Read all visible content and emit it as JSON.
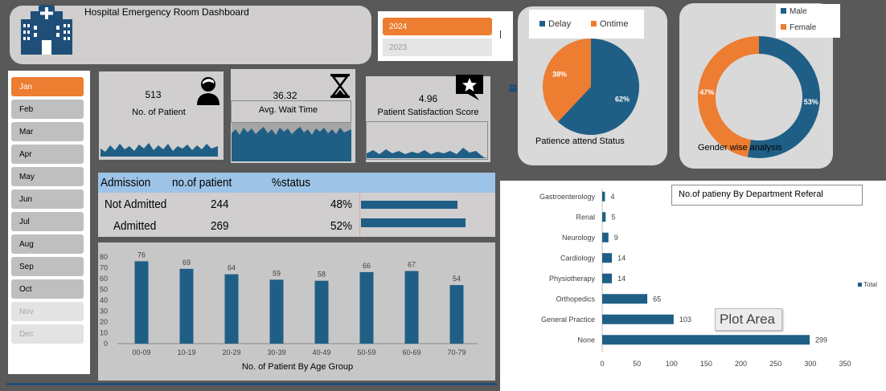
{
  "header": {
    "title": "Hospital Emergency Room Dashboard",
    "logo_icon": "hospital-icon"
  },
  "years": [
    {
      "label": "2024",
      "selected": true
    },
    {
      "label": "2023",
      "selected": false
    }
  ],
  "months": [
    {
      "label": "Jan",
      "state": "on"
    },
    {
      "label": "Feb",
      "state": ""
    },
    {
      "label": "Mar",
      "state": ""
    },
    {
      "label": "Apr",
      "state": ""
    },
    {
      "label": "May",
      "state": ""
    },
    {
      "label": "Jun",
      "state": ""
    },
    {
      "label": "Jul",
      "state": ""
    },
    {
      "label": "Aug",
      "state": ""
    },
    {
      "label": "Sep",
      "state": ""
    },
    {
      "label": "Oct",
      "state": ""
    },
    {
      "label": "Nov",
      "state": "off"
    },
    {
      "label": "Dec",
      "state": "off"
    }
  ],
  "kpis": {
    "patients": {
      "value": "513",
      "label": "No. of Patient",
      "icon": "person-icon"
    },
    "wait": {
      "value": "36.32",
      "label": "Avg. Wait Time",
      "icon": "hourglass-icon"
    },
    "satisfaction": {
      "value": "4.96",
      "label": "Patient Satisfaction Score",
      "icon": "star-speech-icon"
    }
  },
  "admission": {
    "headers": [
      "Admission",
      "no.of patient",
      "%status"
    ],
    "rows": [
      {
        "label": "Not Admitted",
        "count": "244",
        "pct": "48%",
        "fraction": 0.48
      },
      {
        "label": "Admitted",
        "count": "269",
        "pct": "52%",
        "fraction": 0.52
      }
    ]
  },
  "status_pie": {
    "caption": "Patience attend Status",
    "legend": [
      "Delay",
      "Ontime"
    ],
    "slices": [
      {
        "name": "Delay",
        "value": 62,
        "label": "62%",
        "color": "#1f5f86"
      },
      {
        "name": "Ontime",
        "value": 38,
        "label": "38%",
        "color": "#ed7d31"
      }
    ]
  },
  "gender_donut": {
    "caption": "Gender wise analysis",
    "legend": [
      "Male",
      "Female"
    ],
    "slices": [
      {
        "name": "Male",
        "value": 53,
        "label": "53%",
        "color": "#1f5f86"
      },
      {
        "name": "Female",
        "value": 47,
        "label": "47%",
        "color": "#ed7d31"
      }
    ]
  },
  "colors": {
    "accent": "#ed7d31",
    "bar": "#1f5f86",
    "panel": "#d0cece",
    "background": "#595959"
  },
  "chart_data": [
    {
      "type": "bar",
      "xlabel": "No. of Patient By Age Group",
      "categories": [
        "00-09",
        "10-19",
        "20-29",
        "30-39",
        "40-49",
        "50-59",
        "60-69",
        "70-79"
      ],
      "values": [
        76,
        69,
        64,
        59,
        58,
        66,
        67,
        54
      ],
      "ylim": [
        0,
        80
      ],
      "yticks": [
        0,
        10,
        20,
        30,
        40,
        50,
        60,
        70,
        80
      ]
    },
    {
      "type": "bar",
      "orientation": "horizontal",
      "title": "No.of patieny By Department Referal",
      "categories": [
        "Gastroenterology",
        "Renal",
        "Neurology",
        "Cardiology",
        "Physiotherapy",
        "Orthopedics",
        "General Practice",
        "None"
      ],
      "series": [
        {
          "name": "Total",
          "values": [
            4,
            5,
            9,
            14,
            14,
            65,
            103,
            299
          ]
        }
      ],
      "xlim": [
        0,
        350
      ],
      "xticks": [
        0,
        50,
        100,
        150,
        200,
        250,
        300,
        350
      ],
      "legend": "right",
      "tooltip": "Plot Area"
    }
  ]
}
